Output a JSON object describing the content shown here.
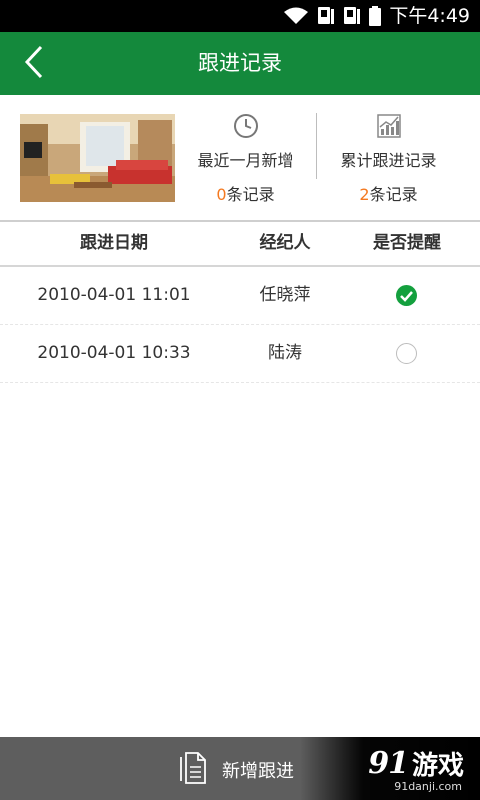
{
  "status_bar": {
    "time": "下午4:49"
  },
  "header": {
    "title": "跟进记录"
  },
  "summary": {
    "recent": {
      "label": "最近一月新增",
      "count": "0",
      "suffix": "条记录"
    },
    "total": {
      "label": "累计跟进记录",
      "count": "2",
      "suffix": "条记录"
    }
  },
  "table": {
    "headers": [
      "跟进日期",
      "经纪人",
      "是否提醒"
    ],
    "rows": [
      {
        "date": "2010-04-01 11:01",
        "agent": "任晓萍",
        "reminder": true
      },
      {
        "date": "2010-04-01 10:33",
        "agent": "陆涛",
        "reminder": false
      }
    ]
  },
  "bottom_bar": {
    "label": "新增跟进"
  },
  "watermark": {
    "brand": "91",
    "name": "游戏",
    "url": "91danji.com"
  },
  "colors": {
    "header_green": "#14893c",
    "accent_orange": "#f47920",
    "check_green": "#14a03e",
    "bottom_gray": "#5e5e5e"
  }
}
